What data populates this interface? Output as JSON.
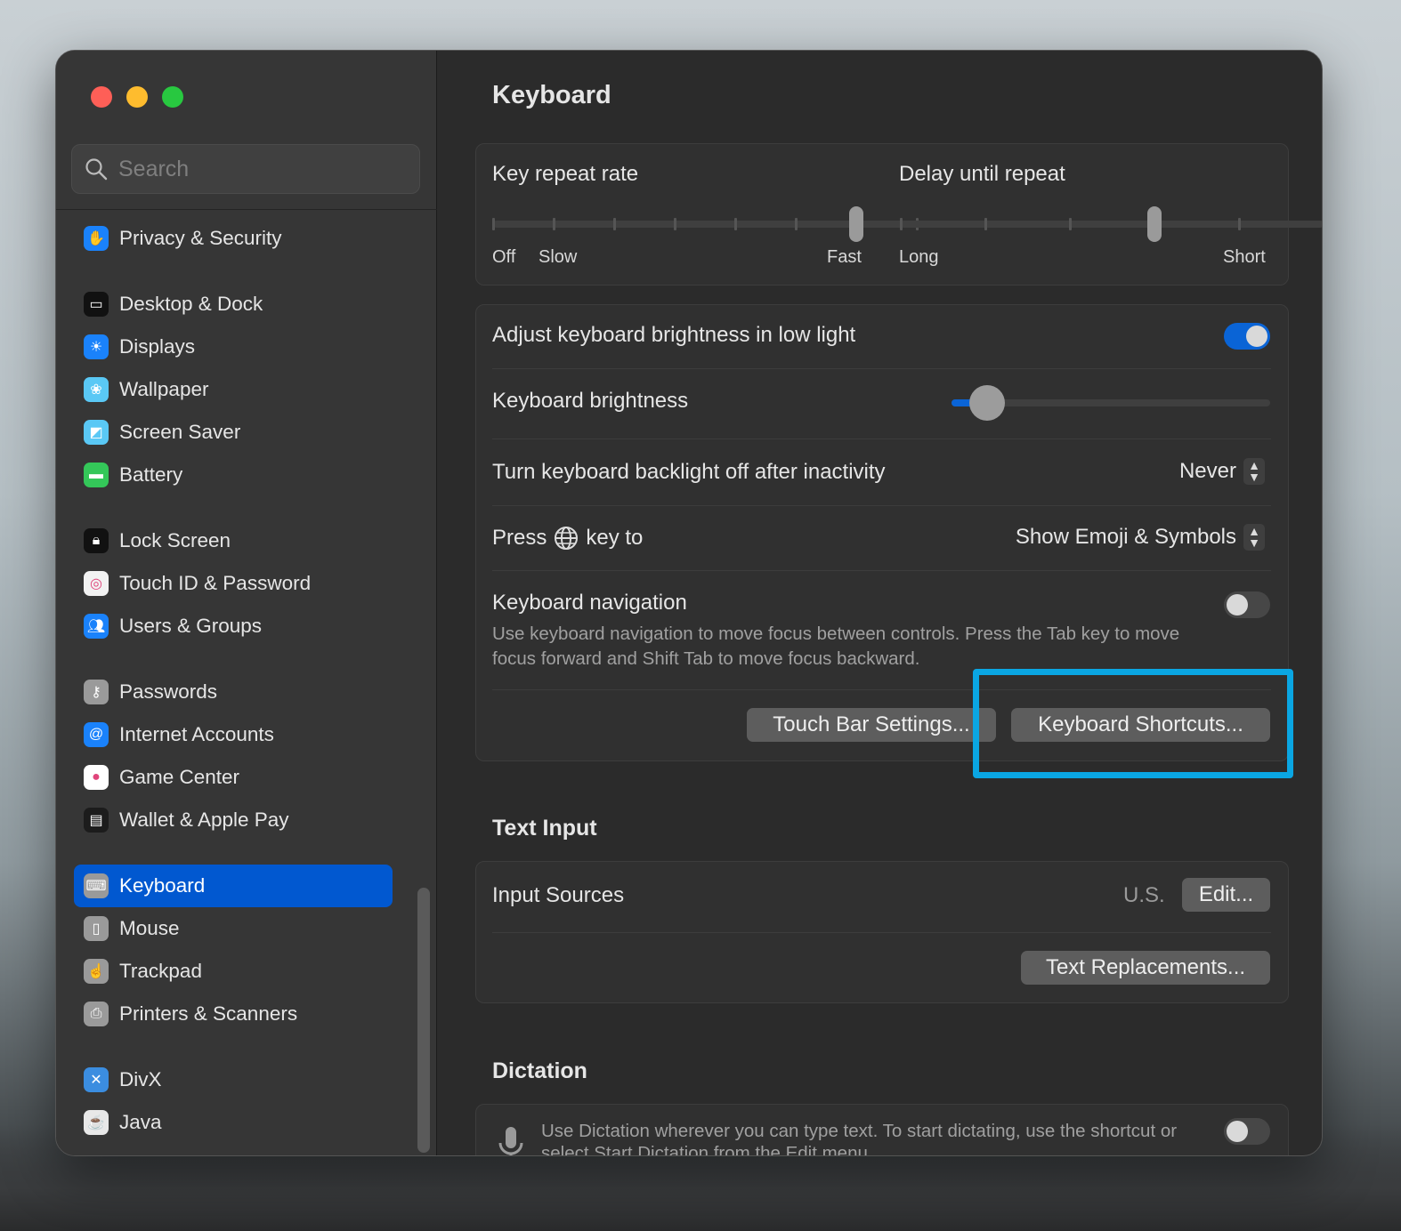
{
  "window": {
    "traffic_lights": {
      "close": "#fe5f57",
      "minimize": "#febc2e",
      "zoom": "#28c840"
    }
  },
  "sidebar": {
    "search_placeholder": "Search",
    "items": [
      {
        "label": "Privacy & Security",
        "icon": "hand-icon",
        "color": "#1a82fb"
      },
      {
        "label": "Desktop & Dock",
        "icon": "dock-icon",
        "color": "#111111"
      },
      {
        "label": "Displays",
        "icon": "sun-icon",
        "color": "#1a82fb"
      },
      {
        "label": "Wallpaper",
        "icon": "flower-icon",
        "color": "#5ac8f5"
      },
      {
        "label": "Screen Saver",
        "icon": "screen-saver-icon",
        "color": "#5ac8f5"
      },
      {
        "label": "Battery",
        "icon": "battery-icon",
        "color": "#34c759"
      },
      {
        "label": "Lock Screen",
        "icon": "lock-icon",
        "color": "#111111"
      },
      {
        "label": "Touch ID & Password",
        "icon": "fingerprint-icon",
        "color": "#f2f2f2"
      },
      {
        "label": "Users & Groups",
        "icon": "users-icon",
        "color": "#1a82fb"
      },
      {
        "label": "Passwords",
        "icon": "key-icon",
        "color": "#9a9a9a"
      },
      {
        "label": "Internet Accounts",
        "icon": "at-icon",
        "color": "#1a82fb"
      },
      {
        "label": "Game Center",
        "icon": "game-center-icon",
        "color": "#ffffff"
      },
      {
        "label": "Wallet & Apple Pay",
        "icon": "wallet-icon",
        "color": "#1c1c1c"
      },
      {
        "label": "Keyboard",
        "icon": "keyboard-icon",
        "color": "#9a9a9a",
        "selected": true
      },
      {
        "label": "Mouse",
        "icon": "mouse-icon",
        "color": "#9a9a9a"
      },
      {
        "label": "Trackpad",
        "icon": "trackpad-icon",
        "color": "#9a9a9a"
      },
      {
        "label": "Printers & Scanners",
        "icon": "printer-icon",
        "color": "#9a9a9a"
      },
      {
        "label": "DivX",
        "icon": "divx-icon",
        "color": "#3b8de0"
      },
      {
        "label": "Java",
        "icon": "java-icon",
        "color": "#e8e8e8"
      }
    ]
  },
  "main": {
    "title": "Keyboard",
    "key_repeat": {
      "label": "Key repeat rate",
      "min_labels": [
        "Off",
        "Slow"
      ],
      "max_label": "Fast",
      "steps": 8,
      "value_index": 6
    },
    "delay": {
      "label": "Delay until repeat",
      "min_label": "Long",
      "max_label": "Short",
      "steps": 6,
      "value_index": 3
    },
    "adjust_brightness": {
      "label": "Adjust keyboard brightness in low light",
      "on": true
    },
    "brightness": {
      "label": "Keyboard brightness",
      "value": 0.1
    },
    "backlight": {
      "label": "Turn keyboard backlight off after inactivity",
      "value": "Never"
    },
    "press_key": {
      "label_before": "Press",
      "label_after": "key to",
      "value": "Show Emoji & Symbols"
    },
    "keyboard_nav": {
      "label": "Keyboard navigation",
      "description": "Use keyboard navigation to move focus between controls. Press the Tab key to move focus forward and Shift Tab to move focus backward.",
      "on": false
    },
    "touch_bar_button": "Touch Bar Settings...",
    "shortcuts_button": "Keyboard Shortcuts...",
    "text_input": {
      "heading": "Text Input",
      "input_sources_label": "Input Sources",
      "input_sources_value": "U.S.",
      "edit_button": "Edit...",
      "replacements_button": "Text Replacements..."
    },
    "dictation": {
      "heading": "Dictation",
      "description": "Use Dictation wherever you can type text. To start dictating, use the shortcut or select Start Dictation from the Edit menu.",
      "on": false
    },
    "accent": "#0a64d6",
    "highlight_color": "#0aa6e3"
  }
}
